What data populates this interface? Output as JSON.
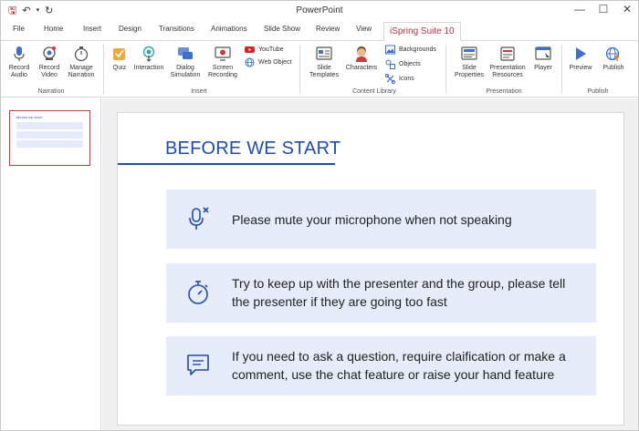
{
  "window": {
    "title": "PowerPoint"
  },
  "qat": {
    "save": "🖫",
    "undo": "↶",
    "undo_arrow": "▾",
    "redo": "↻"
  },
  "window_controls": {
    "minimize": "—",
    "maximize": "☐",
    "close": "✕"
  },
  "tabs": [
    {
      "label": "File"
    },
    {
      "label": "Home"
    },
    {
      "label": "Insert"
    },
    {
      "label": "Design"
    },
    {
      "label": "Transitions"
    },
    {
      "label": "Animations"
    },
    {
      "label": "Slide Show"
    },
    {
      "label": "Review"
    },
    {
      "label": "View"
    },
    {
      "label": "iSpring Suite 10",
      "active": true
    }
  ],
  "ribbon": {
    "narration": {
      "label": "Narration",
      "record_audio": "Record Audio",
      "record_video": "Record Video",
      "manage_narration": "Manage Narration"
    },
    "insert": {
      "label": "Insert",
      "quiz": "Quiz",
      "interaction": "Interaction",
      "dialog_simulation": "Dialog Simulation",
      "screen_recording": "Screen Recording",
      "youtube": "YouTube",
      "web_object": "Web Object"
    },
    "content_library": {
      "label": "Content Library",
      "slide_templates": "Slide Templates",
      "characters": "Characters",
      "backgrounds": "Backgrounds",
      "objects": "Objects",
      "icons": "Icons"
    },
    "presentation": {
      "label": "Presentation",
      "slide_properties": "Slide Properties",
      "presentation_resources": "Presentation Resources",
      "player": "Player"
    },
    "publish": {
      "label": "Publish",
      "preview": "Preview",
      "publish": "Publish"
    }
  },
  "slide": {
    "title": "BEFORE WE START",
    "items": [
      {
        "icon": "microphone-muted-icon",
        "text": "Please mute your microphone when not speaking"
      },
      {
        "icon": "stopwatch-icon",
        "text": "Try to keep up with the presenter and the group, please tell the presenter if they are going too fast"
      },
      {
        "icon": "chat-bubble-icon",
        "text": "If you need to ask a question, require claification or make a comment, use the chat feature or raise your hand feature"
      }
    ]
  },
  "thumbnail": {
    "title": "BEFORE WE START"
  },
  "colors": {
    "accent": "#c02e40",
    "slide_title": "#1f4bb3",
    "card_bg": "#e7ecfb"
  }
}
